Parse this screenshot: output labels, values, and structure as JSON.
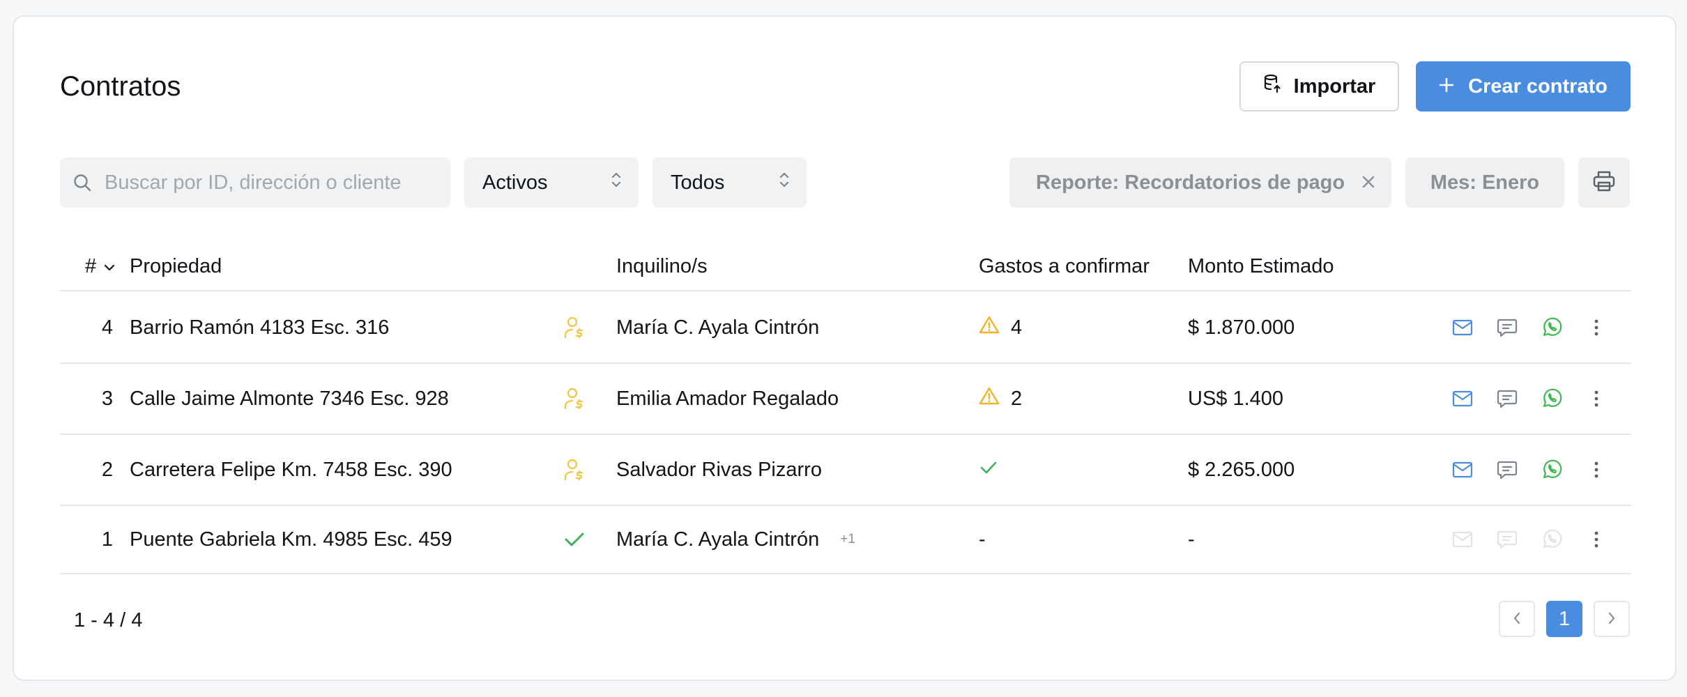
{
  "header": {
    "title": "Contratos",
    "import_label": "Importar",
    "create_label": "Crear contrato"
  },
  "filters": {
    "search_placeholder": "Buscar por ID, dirección o cliente",
    "status_value": "Activos",
    "type_value": "Todos",
    "report_chip": "Reporte: Recordatorios de pago",
    "month_chip": "Mes: Enero"
  },
  "table": {
    "columns": {
      "num": "#",
      "property": "Propiedad",
      "tenants": "Inquilino/s",
      "expenses": "Gastos a confirmar",
      "amount": "Monto Estimado"
    },
    "rows": [
      {
        "num": "4",
        "property": "Barrio Ramón 4183 Esc. 316",
        "status_icon": "user-dollar-icon",
        "tenant": "María C. Ayala Cintrón",
        "extra": "",
        "expenses_icon": "warning-icon",
        "expenses": "4",
        "amount": "$ 1.870.000",
        "actions_enabled": true
      },
      {
        "num": "3",
        "property": "Calle Jaime Almonte 7346 Esc. 928",
        "status_icon": "user-dollar-icon",
        "tenant": "Emilia Amador Regalado",
        "extra": "",
        "expenses_icon": "warning-icon",
        "expenses": "2",
        "amount": "US$ 1.400",
        "actions_enabled": true
      },
      {
        "num": "2",
        "property": "Carretera Felipe Km. 7458 Esc. 390",
        "status_icon": "user-dollar-icon",
        "tenant": "Salvador Rivas Pizarro",
        "extra": "",
        "expenses_icon": "check-icon",
        "expenses": "",
        "amount": "$ 2.265.000",
        "actions_enabled": true
      },
      {
        "num": "1",
        "property": "Puente Gabriela Km. 4985 Esc. 459",
        "status_icon": "check-icon",
        "tenant": "María C. Ayala Cintrón",
        "extra": "+1",
        "expenses_icon": "",
        "expenses": "-",
        "amount": "-",
        "actions_enabled": false
      }
    ]
  },
  "pagination": {
    "range": "1 - 4 / 4",
    "current_page": "1"
  },
  "colors": {
    "accent": "#4a8de0",
    "warning": "#f0b429",
    "success": "#3fae5a",
    "user_dollar": "#f2c53d",
    "whatsapp": "#3fb950",
    "muted": "#8b9097"
  }
}
